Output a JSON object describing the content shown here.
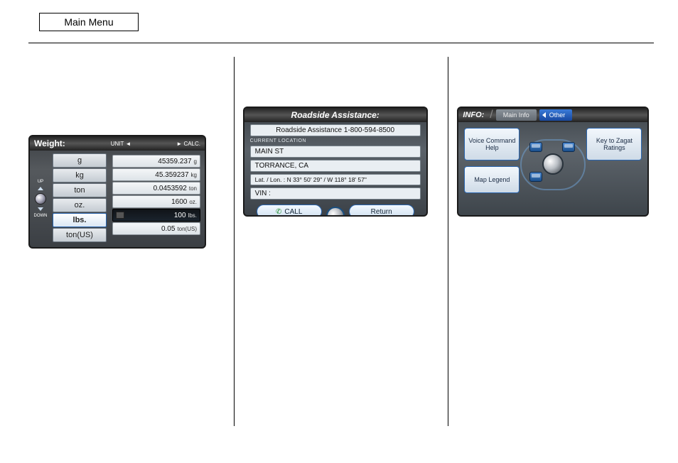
{
  "main_menu": "Main Menu",
  "weight": {
    "title": "Weight:",
    "unit_label": "UNIT ◄",
    "calc_label": "► CALC.",
    "up": "UP",
    "down": "DOWN",
    "units": [
      "g",
      "kg",
      "ton",
      "oz.",
      "lbs.",
      "ton(US)"
    ],
    "active_unit_index": 4,
    "values": [
      {
        "v": "45359.237",
        "u": "g"
      },
      {
        "v": "45.359237",
        "u": "kg"
      },
      {
        "v": "0.0453592",
        "u": "ton"
      },
      {
        "v": "1600",
        "u": "oz."
      },
      {
        "v": "100",
        "u": "lbs.",
        "active": true,
        "flag": true
      },
      {
        "v": "0.05",
        "u": "ton(US)"
      }
    ]
  },
  "roadside": {
    "title": "Roadside Assistance:",
    "line": "Roadside Assistance 1-800-594-8500",
    "loc_label": "CURRENT LOCATION",
    "street": "MAIN ST",
    "city": "TORRANCE, CA",
    "latlon": "Lat. / Lon. : N 33° 50' 29\" / W 118° 18' 57\"",
    "vin": "VIN :",
    "call": "CALL",
    "return": "Return"
  },
  "info": {
    "label": "INFO:",
    "tab_main": "Main Info",
    "tab_other": "Other",
    "btn_voice": "Voice Command Help",
    "btn_zagat": "Key to Zagat Ratings",
    "btn_legend": "Map Legend"
  }
}
